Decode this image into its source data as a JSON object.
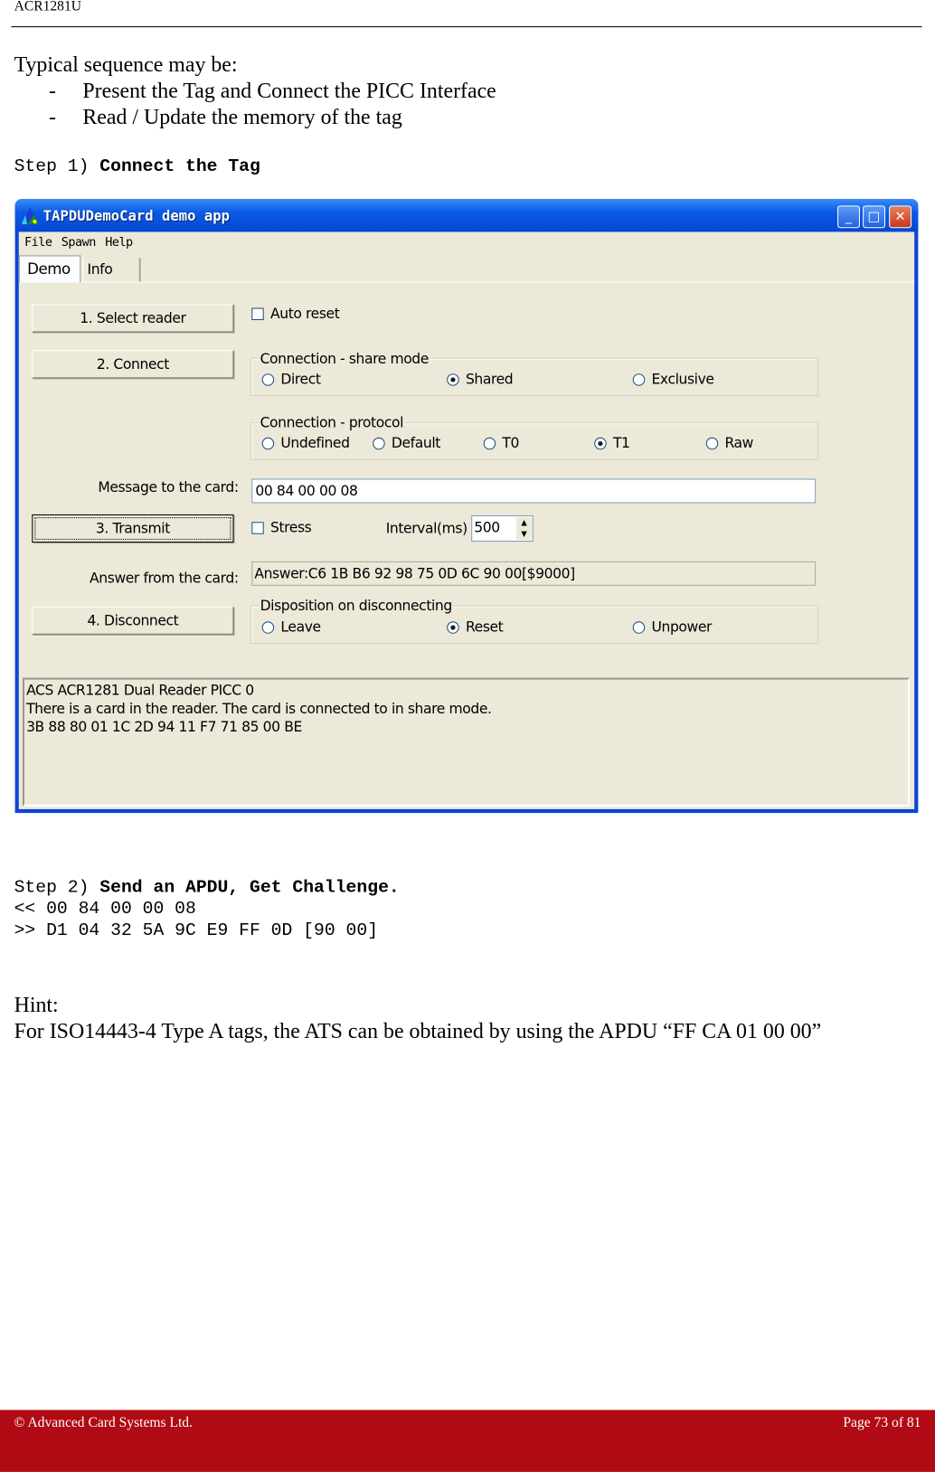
{
  "header": {
    "title": "ACR1281U"
  },
  "intro": {
    "heading": "Typical sequence may be:",
    "items": [
      "Present the Tag and Connect the PICC Interface",
      "Read / Update the memory of the tag"
    ]
  },
  "step1": {
    "prefix": "Step 1)",
    "label": "Connect the Tag"
  },
  "app": {
    "title": "TAPDUDemoCard demo app",
    "menu": [
      "File",
      "Spawn",
      "Help"
    ],
    "tabs": [
      "Demo",
      "Info"
    ],
    "buttons": {
      "select_reader": "1. Select reader",
      "connect": "2. Connect",
      "transmit": "3. Transmit",
      "disconnect": "4. Disconnect"
    },
    "auto_reset": {
      "label": "Auto reset",
      "checked": false
    },
    "share_mode": {
      "label": "Connection - share mode",
      "options": [
        "Direct",
        "Shared",
        "Exclusive"
      ],
      "selected": "Shared"
    },
    "protocol": {
      "label": "Connection - protocol",
      "options": [
        "Undefined",
        "Default",
        "T0",
        "T1",
        "Raw"
      ],
      "selected": "T1"
    },
    "message": {
      "label": "Message to the card:",
      "value": "00 84 00 00 08"
    },
    "stress": {
      "label": "Stress",
      "checked": false
    },
    "interval": {
      "label": "Interval(ms)",
      "value": "500"
    },
    "answer": {
      "label": "Answer from the card:",
      "value": "Answer:C6 1B B6 92 98 75 0D 6C 90 00[$9000]"
    },
    "disposition": {
      "label": "Disposition on disconnecting",
      "options": [
        "Leave",
        "Reset",
        "Unpower"
      ],
      "selected": "Reset"
    },
    "log": [
      "ACS ACR1281 Dual Reader PICC 0",
      "There is a card in the reader. The card is connected to in share mode.",
      "3B 88 80 01 1C 2D 94 11 F7 71 85 00 BE"
    ]
  },
  "step2": {
    "prefix": "Step 2)",
    "label": "Send an APDU, Get Challenge.",
    "lines": [
      "<< 00 84 00 00 08",
      ">> D1 04 32 5A 9C E9 FF 0D [90 00]"
    ]
  },
  "hint": {
    "title": "Hint:",
    "text": "For ISO14443-4 Type A tags, the ATS can be obtained by using the APDU “FF CA 01 00 00”"
  },
  "footer": {
    "copyright": "© Advanced Card Systems Ltd.",
    "page": "Page 73 of 81",
    "color": "#b00a14"
  }
}
